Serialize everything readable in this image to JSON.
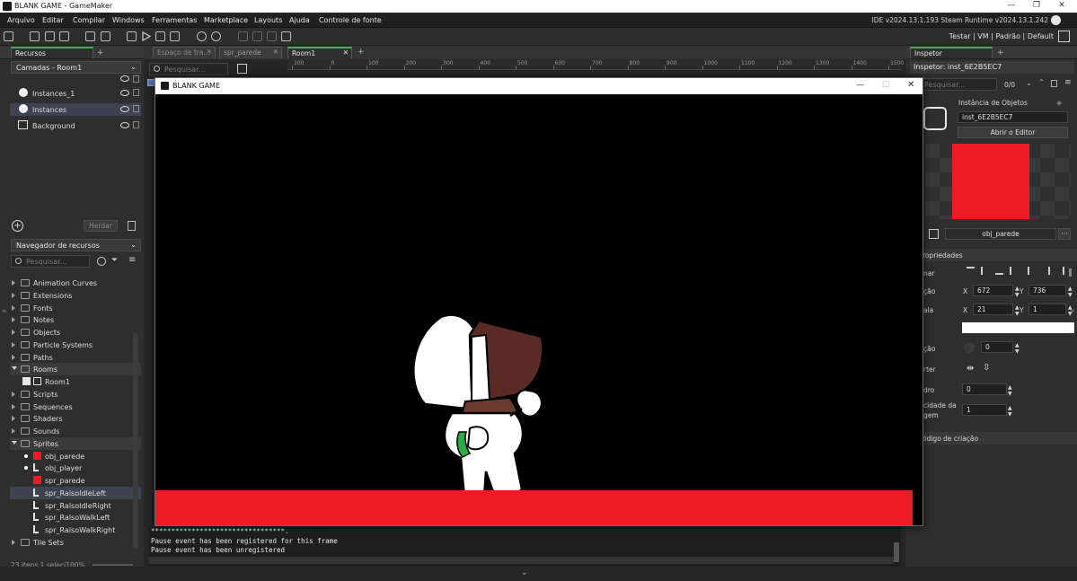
{
  "window": {
    "title": "BLANK GAME - GameMaker"
  },
  "menu": [
    "Arquivo",
    "Editar",
    "Compilar",
    "Windows",
    "Ferramentas",
    "Marketplace",
    "Layouts",
    "Ajuda",
    "Controle de fonte"
  ],
  "version": "IDE v2024.13.1.193 Steam  Runtime v2024.13.1.242",
  "toolbar_right": "Testar | VM | Padrão | Default",
  "left_panel": {
    "tab": "Recursos",
    "layers_select": "Camadas - Room1",
    "layers": [
      {
        "name": "Instances_1"
      },
      {
        "name": "Instances"
      },
      {
        "name": "Background"
      }
    ],
    "inherit_button": "Herdar",
    "nav_select": "Navegador de recursos",
    "search_placeholder": "Pesquisar...",
    "tree": [
      {
        "label": "Animation Curves",
        "type": "folder"
      },
      {
        "label": "Extensions",
        "type": "folder"
      },
      {
        "label": "Fonts",
        "type": "folder"
      },
      {
        "label": "Notes",
        "type": "folder"
      },
      {
        "label": "Objects",
        "type": "folder"
      },
      {
        "label": "Particle Systems",
        "type": "folder"
      },
      {
        "label": "Paths",
        "type": "folder"
      },
      {
        "label": "Rooms",
        "type": "folder-open"
      },
      {
        "label": "Room1",
        "type": "room"
      },
      {
        "label": "Scripts",
        "type": "folder"
      },
      {
        "label": "Sequences",
        "type": "folder"
      },
      {
        "label": "Shaders",
        "type": "folder"
      },
      {
        "label": "Sounds",
        "type": "folder"
      },
      {
        "label": "Sprites",
        "type": "folder-open"
      },
      {
        "label": "obj_parede",
        "type": "red"
      },
      {
        "label": "obj_player",
        "type": "sprite"
      },
      {
        "label": "spr_parede",
        "type": "red"
      },
      {
        "label": "spr_RalsoIdleLeft",
        "type": "sprite"
      },
      {
        "label": "spr_RalsoIdleRight",
        "type": "sprite"
      },
      {
        "label": "spr_RalsoWalkLeft",
        "type": "sprite"
      },
      {
        "label": "spr_RalsoWalkRight",
        "type": "sprite"
      },
      {
        "label": "Tile Sets",
        "type": "folder"
      }
    ],
    "footer": "23 itens   1 seleci100%"
  },
  "editor_tabs": [
    "Espaço de tra...",
    "spr_parede",
    "Room1"
  ],
  "room_search_placeholder": "Pesquisar...",
  "ruler_labels": [
    "100",
    "0",
    "100",
    "200",
    "300",
    "400",
    "500",
    "600",
    "700",
    "800",
    "900",
    "1000",
    "1100",
    "1200",
    "1300",
    "1400",
    "1500"
  ],
  "game_window": {
    "title": "BLANK GAME"
  },
  "console_lines": [
    "*********************************.",
    "Pause event has been registered for this frame",
    "Pause event has been unregistered"
  ],
  "right_panel": {
    "tab": "Inspetor",
    "header": "Inspetor: inst_6E2B5EC7",
    "search_placeholder": "Pesquisar...",
    "count": "0/0",
    "instance_title": "Instância de Objetos",
    "instance_name": "inst_6E2B5EC7",
    "open_editor": "Abrir o Editor",
    "object_name": "obj_parede",
    "more": "···",
    "properties_title": "ropriedades",
    "labels": {
      "align": "nar",
      "position": "ção",
      "scale": "ala",
      "rotation": "ção",
      "flip": "rter",
      "frame": "dro",
      "speed_1": "cidade da",
      "speed_2": "gem",
      "creation_code": "ódigo de criação"
    },
    "x_label": "X",
    "y_label": "Y",
    "pos_x": "672",
    "pos_y": "736",
    "scale_x": "21",
    "scale_y": "1",
    "rotation": "0",
    "frame": "0",
    "speed": "1"
  },
  "colors": {
    "accent_green": "#3fb24f",
    "wall_red": "#ed1c24"
  }
}
